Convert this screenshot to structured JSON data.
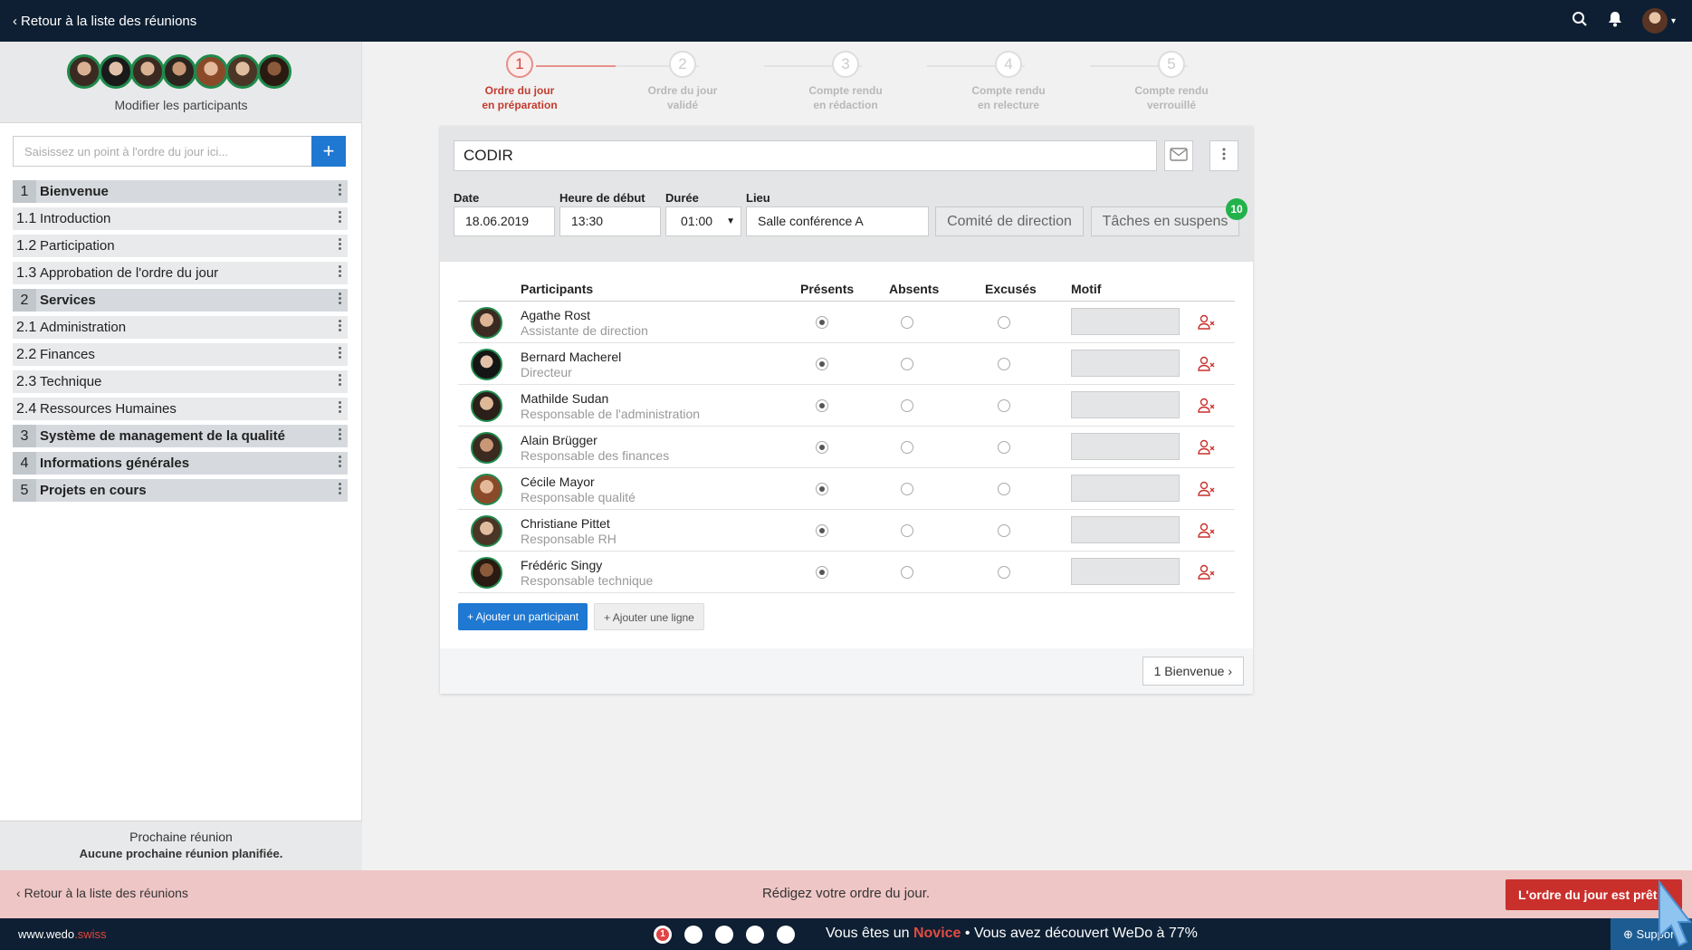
{
  "topbar": {
    "back_label": "Retour à la liste des réunions"
  },
  "sidebar": {
    "modify_label": "Modifier les participants",
    "input_placeholder": "Saisissez un point à l'ordre du jour ici...",
    "add_label": "+",
    "agenda": [
      {
        "num": "1",
        "label": "Bienvenue",
        "main": true
      },
      {
        "num": "1.1",
        "label": "Introduction",
        "main": false
      },
      {
        "num": "1.2",
        "label": "Participation",
        "main": false
      },
      {
        "num": "1.3",
        "label": "Approbation de l'ordre du jour",
        "main": false
      },
      {
        "num": "2",
        "label": "Services",
        "main": true
      },
      {
        "num": "2.1",
        "label": "Administration",
        "main": false
      },
      {
        "num": "2.2",
        "label": "Finances",
        "main": false
      },
      {
        "num": "2.3",
        "label": "Technique",
        "main": false
      },
      {
        "num": "2.4",
        "label": "Ressources Humaines",
        "main": false
      },
      {
        "num": "3",
        "label": "Système de management de la qualité",
        "main": true
      },
      {
        "num": "4",
        "label": "Informations générales",
        "main": true
      },
      {
        "num": "5",
        "label": "Projets en cours",
        "main": true
      }
    ],
    "next_meeting_label": "Prochaine réunion",
    "next_meeting_value": "Aucune prochaine réunion planifiée."
  },
  "stepper": [
    {
      "num": "1",
      "line1": "Ordre du jour",
      "line2": "en préparation",
      "active": true
    },
    {
      "num": "2",
      "line1": "Ordre du jour",
      "line2": "validé",
      "active": false
    },
    {
      "num": "3",
      "line1": "Compte rendu",
      "line2": "en rédaction",
      "active": false
    },
    {
      "num": "4",
      "line1": "Compte rendu",
      "line2": "en relecture",
      "active": false
    },
    {
      "num": "5",
      "line1": "Compte rendu",
      "line2": "verrouillé",
      "active": false
    }
  ],
  "meeting": {
    "title": "CODIR",
    "date_label": "Date",
    "date_value": "18.06.2019",
    "start_label": "Heure de début",
    "start_value": "13:30",
    "duration_label": "Durée",
    "duration_value": "01:00",
    "place_label": "Lieu",
    "place_value": "Salle conférence A",
    "committee_label": "Comité de direction",
    "pending_label": "Tâches en suspens",
    "pending_count": "10"
  },
  "participants_table": {
    "headers": {
      "participants": "Participants",
      "present": "Présents",
      "absent": "Absents",
      "excused": "Excusés",
      "reason": "Motif"
    },
    "rows": [
      {
        "name": "Agathe Rost",
        "role": "Assistante de direction"
      },
      {
        "name": "Bernard Macherel",
        "role": "Directeur"
      },
      {
        "name": "Mathilde Sudan",
        "role": "Responsable de l'administration"
      },
      {
        "name": "Alain Brügger",
        "role": "Responsable des finances"
      },
      {
        "name": "Cécile Mayor",
        "role": "Responsable qualité"
      },
      {
        "name": "Christiane Pittet",
        "role": "Responsable RH"
      },
      {
        "name": "Frédéric Singy",
        "role": "Responsable technique"
      }
    ],
    "add_participant_label": "+ Ajouter un participant",
    "add_line_label": "+ Ajouter une ligne",
    "next_label": "1 Bienvenue ›"
  },
  "bottom_bar": {
    "back_label": "Retour à la liste des réunions",
    "message": "Rédigez votre ordre du jour.",
    "ready_label": "L'ordre du jour est prêt"
  },
  "footer": {
    "brand_main": "www.wedo",
    "brand_suffix": ".swiss",
    "novice_prefix": "Vous êtes un",
    "novice_level": "Novice",
    "novice_suffix": "• Vous avez découvert WeDo à 77%",
    "support_label": "Support"
  },
  "colors": {
    "accent_blue": "#1f78d1",
    "danger_red": "#c9302c",
    "dark_nav": "#0e1f33",
    "green_ring": "#1f8a4c"
  }
}
